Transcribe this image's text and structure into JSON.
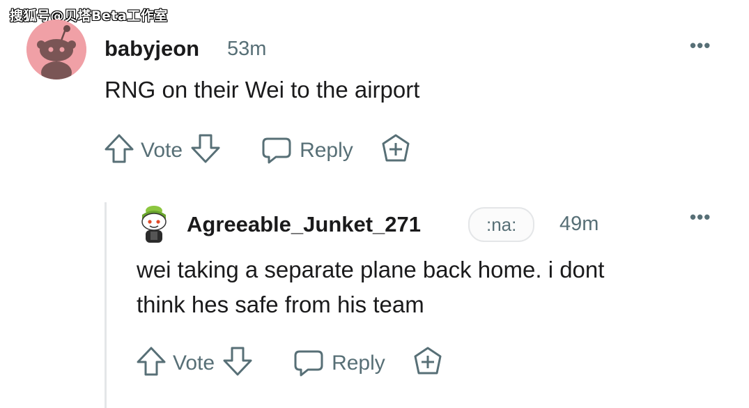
{
  "watermark": "搜狐号@贝塔Beta工作室",
  "parent_comment": {
    "username": "babyjeon",
    "time": "53m",
    "body": "RNG on their Wei to the airport",
    "vote_label": "Vote",
    "reply_label": "Reply",
    "more_label": "•••"
  },
  "reply_comment": {
    "username": "Agreeable_Junket_271",
    "flair": ":na:",
    "time": "49m",
    "body_line1": "wei taking a separate plane back home. i dont",
    "body_line2": "think hes safe from his team",
    "vote_label": "Vote",
    "reply_label": "Reply",
    "more_label": "•••"
  },
  "colors": {
    "text": "#1a1a1b",
    "meta": "#576f76",
    "avatar_bg": "#f0a0a6",
    "thread_line": "#e4e6e8"
  },
  "icons": [
    "reddit-snoo-avatar-icon",
    "upvote-arrow-icon",
    "downvote-arrow-icon",
    "comment-bubble-icon",
    "award-plus-icon",
    "more-options-icon"
  ]
}
